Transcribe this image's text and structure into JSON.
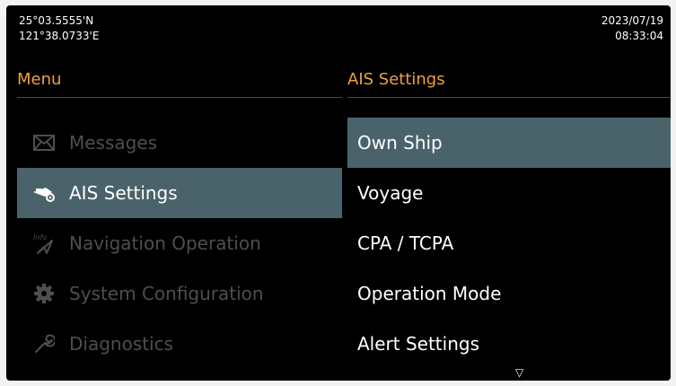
{
  "status": {
    "lat": "25°03.5555'N",
    "lon": "121°38.0733'E",
    "date": "2023/07/19",
    "time": "08:33:04"
  },
  "menu": {
    "title": "Menu",
    "items": [
      {
        "label": "Messages",
        "icon": "envelope-icon",
        "state": "disabled"
      },
      {
        "label": "AIS Settings",
        "icon": "ship-settings-icon",
        "state": "selected"
      },
      {
        "label": "Navigation Operation",
        "icon": "info-navigation-icon",
        "state": "disabled"
      },
      {
        "label": "System Configuration",
        "icon": "gear-icon",
        "state": "disabled"
      },
      {
        "label": "Diagnostics",
        "icon": "wrench-icon",
        "state": "disabled"
      }
    ]
  },
  "submenu": {
    "title": "AIS Settings",
    "items": [
      {
        "label": "Own Ship",
        "state": "selected"
      },
      {
        "label": "Voyage"
      },
      {
        "label": "CPA / TCPA"
      },
      {
        "label": "Operation Mode"
      },
      {
        "label": "Alert Settings"
      }
    ],
    "more_indicator": "▽"
  },
  "colors": {
    "header": "#f0a03c",
    "selection": "#4a636b",
    "disabled": "#4e4e4e"
  }
}
